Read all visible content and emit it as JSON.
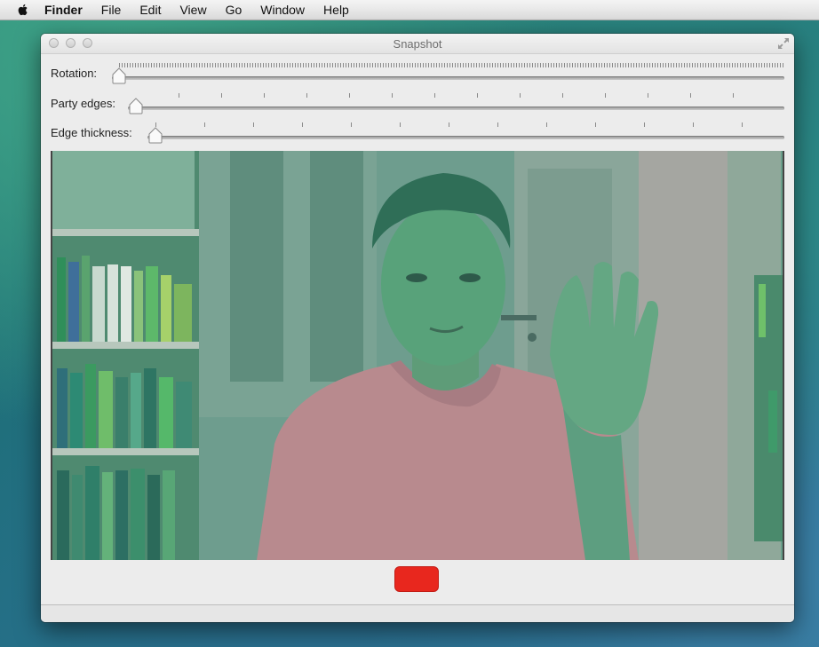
{
  "menubar": {
    "app_name": "Finder",
    "items": [
      "File",
      "Edit",
      "View",
      "Go",
      "Window",
      "Help"
    ]
  },
  "window": {
    "title": "Snapshot"
  },
  "sliders": [
    {
      "label": "Rotation:",
      "value": 0.0
    },
    {
      "label": "Party edges:",
      "value": 0.0
    },
    {
      "label": "Edge thickness:",
      "value": 0.0
    }
  ],
  "colors": {
    "snap_button": "#e8271e",
    "video_tint": "#5d9a86",
    "shirt": "#b88a8e"
  },
  "icons": [
    "apple-icon",
    "fullscreen-icon",
    "close-icon",
    "minimize-icon",
    "zoom-icon"
  ]
}
